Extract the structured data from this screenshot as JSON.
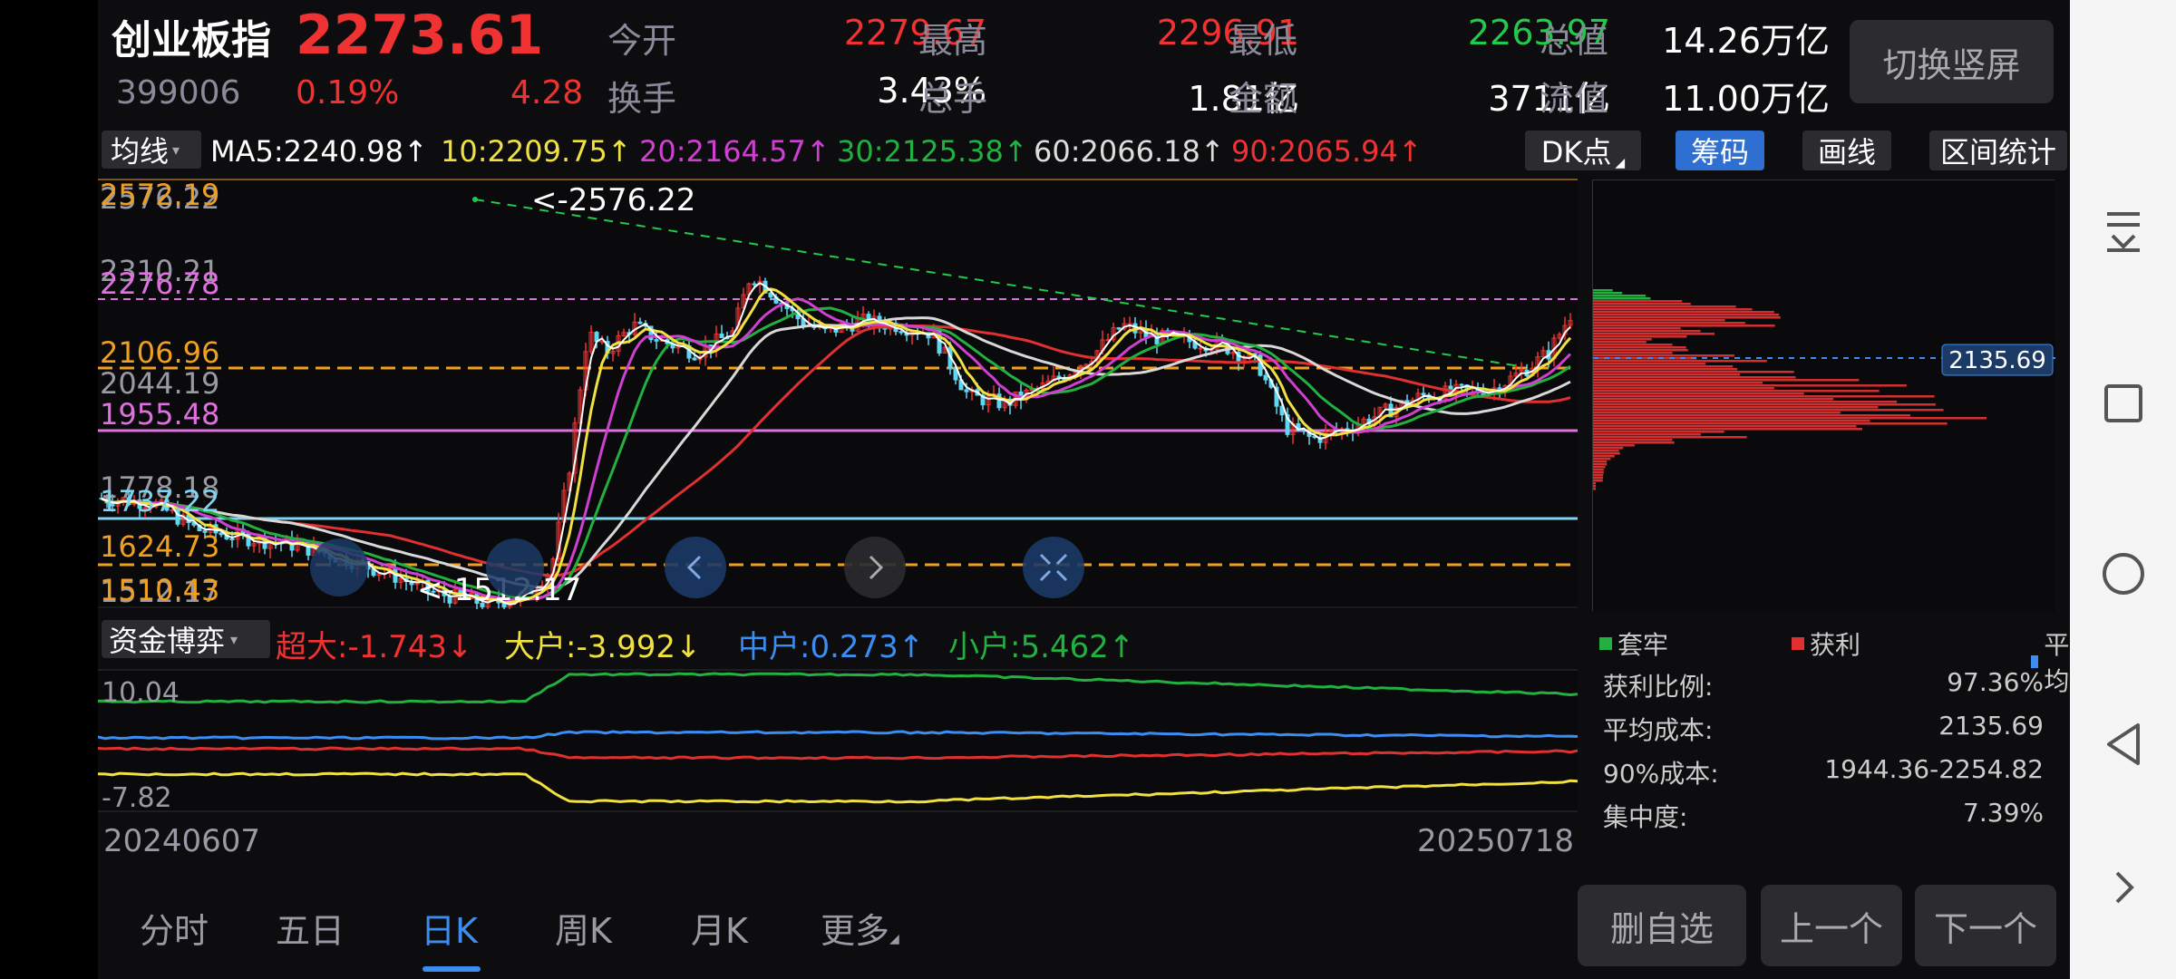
{
  "header": {
    "title": "创业板指",
    "price": "2273.61",
    "code": "399006",
    "change_pct": "0.19%",
    "change": "4.28",
    "button_portrait": "切换竖屏",
    "quotes": [
      {
        "label": "今开",
        "value": "2279.67",
        "color": "#f03232"
      },
      {
        "label": "最高",
        "value": "2296.91",
        "color": "#f03232"
      },
      {
        "label": "最低",
        "value": "2263.97",
        "color": "#22c94a"
      },
      {
        "label": "总值",
        "value": "14.26万亿",
        "color": "#ffffff"
      },
      {
        "label": "换手",
        "value": "3.43%",
        "color": "#ffffff"
      },
      {
        "label": "总手",
        "value": "1.81亿",
        "color": "#ffffff"
      },
      {
        "label": "金额",
        "value": "3711亿",
        "color": "#ffffff"
      },
      {
        "label": "流值",
        "value": "11.00万亿",
        "color": "#ffffff"
      }
    ]
  },
  "ma_bar": {
    "select": "均线",
    "items": [
      {
        "text": "MA5:2240.98↑",
        "color": "#ffffff"
      },
      {
        "text": "10:2209.75↑",
        "color": "#f0e040"
      },
      {
        "text": "20:2164.57↑",
        "color": "#d040d0"
      },
      {
        "text": "30:2125.38↑",
        "color": "#22b040"
      },
      {
        "text": "60:2066.18↑",
        "color": "#dddddd"
      },
      {
        "text": "90:2065.94↑",
        "color": "#f03232"
      }
    ],
    "tools": {
      "dk": "DK点",
      "chip": "筹码",
      "draw": "画线",
      "range": "区间统计"
    }
  },
  "kchart": {
    "price_labels": [
      {
        "text": "2572.19",
        "color": "#f0a020"
      },
      {
        "text": "2576.22",
        "color": "#9a9aa4"
      },
      {
        "text": "2310.21",
        "color": "#9a9aa4"
      },
      {
        "text": "2276.78",
        "color": "#e070e0"
      },
      {
        "text": "2106.96",
        "color": "#f0a020"
      },
      {
        "text": "2044.19",
        "color": "#9a9aa4"
      },
      {
        "text": "1955.48",
        "color": "#e070e0"
      },
      {
        "text": "1778.18",
        "color": "#9a9aa4"
      },
      {
        "text": "1737.22",
        "color": "#7fd4f0"
      },
      {
        "text": "1624.73",
        "color": "#f0a020"
      },
      {
        "text": "1510.43",
        "color": "#f0a020"
      },
      {
        "text": "1512.17",
        "color": "#9a9aa4"
      }
    ],
    "high_marker": "<-2576.22",
    "low_marker": "<-1512.17",
    "chip_price_label": "2135.69"
  },
  "fund": {
    "select": "资金博弈",
    "items": [
      {
        "text": "超大:-1.743↓",
        "color": "#f03232"
      },
      {
        "text": "大户:-3.992↓",
        "color": "#f0e040"
      },
      {
        "text": "中户:0.273↑",
        "color": "#3c8df2"
      },
      {
        "text": "小户:5.462↑",
        "color": "#22b040"
      }
    ],
    "ymax": "10.04",
    "ymin": "-7.82"
  },
  "dates": {
    "start": "20240607",
    "end": "20250718"
  },
  "chip_legend": [
    {
      "text": "套牢",
      "color": "#22b040"
    },
    {
      "text": "获利",
      "color": "#e03030"
    },
    {
      "text": "平均",
      "color": "#3c8df2"
    }
  ],
  "chip_stats": [
    {
      "label": "获利比例:",
      "value": "97.36%"
    },
    {
      "label": "平均成本:",
      "value": "2135.69"
    },
    {
      "label": "90%成本:",
      "value": "1944.36-2254.82"
    },
    {
      "label": "集中度:",
      "value": "7.39%"
    }
  ],
  "tabs": [
    "分时",
    "五日",
    "日K",
    "周K",
    "月K",
    "更多"
  ],
  "bottom_buttons": {
    "delete": "删自选",
    "prev": "上一个",
    "next": "下一个"
  }
}
